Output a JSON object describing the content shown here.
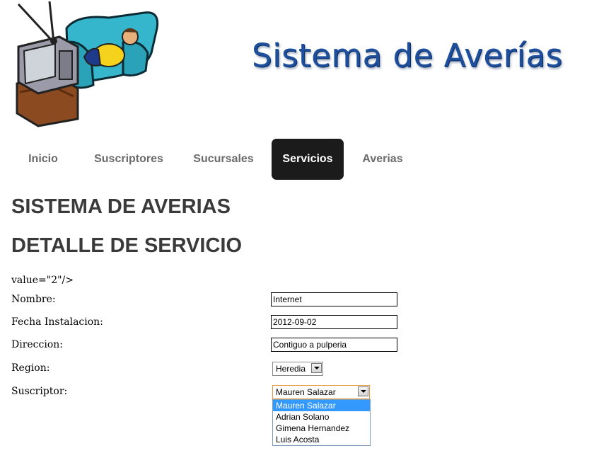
{
  "header": {
    "brand_title": "Sistema de Averías"
  },
  "nav": {
    "items": [
      {
        "label": "Inicio",
        "active": false
      },
      {
        "label": "Suscriptores",
        "active": false
      },
      {
        "label": "Sucursales",
        "active": false
      },
      {
        "label": "Servicios",
        "active": true
      },
      {
        "label": "Averias",
        "active": false
      }
    ]
  },
  "page": {
    "heading1": "SISTEMA DE AVERIAS",
    "heading2": "DETALLE DE SERVICIO",
    "stray_markup": "value=\"2\"/>"
  },
  "form": {
    "nombre": {
      "label": "Nombre:",
      "value": "Internet"
    },
    "fecha": {
      "label": "Fecha Instalacion:",
      "value": "2012-09-02"
    },
    "direccion": {
      "label": "Direccion:",
      "value": "Contiguo a pulperia"
    },
    "region": {
      "label": "Region:",
      "value": "Heredia"
    },
    "suscriptor": {
      "label": "Suscriptor:",
      "value": "Mauren Salazar",
      "options": [
        "Mauren Salazar",
        "Adrian Solano",
        "Gimena Hernandez",
        "Luis Acosta"
      ]
    }
  },
  "colors": {
    "brand_blue": "#1d4f9c",
    "active_tab_bg": "#1b1b1b",
    "selection_blue": "#3399ff",
    "focus_orange": "#e69a3b"
  }
}
